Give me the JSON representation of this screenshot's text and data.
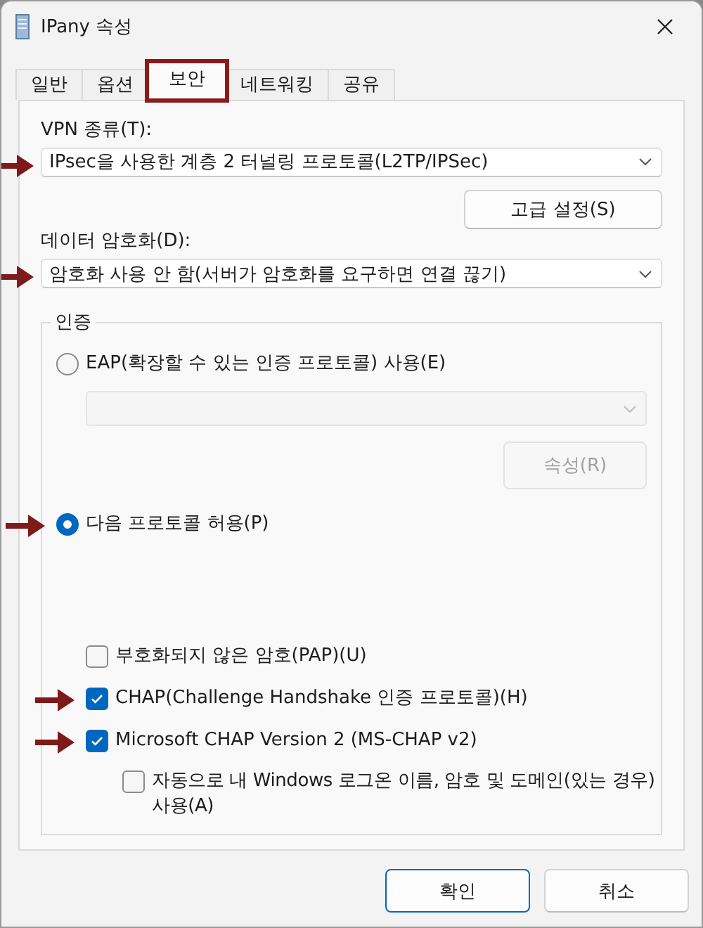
{
  "window": {
    "title": "IPany 속성"
  },
  "tabs": [
    {
      "label": "일반",
      "selected": false,
      "highlighted": false
    },
    {
      "label": "옵션",
      "selected": false,
      "highlighted": false
    },
    {
      "label": "보안",
      "selected": true,
      "highlighted": true
    },
    {
      "label": "네트워킹",
      "selected": false,
      "highlighted": false
    },
    {
      "label": "공유",
      "selected": false,
      "highlighted": false
    }
  ],
  "vpn_type": {
    "label": "VPN 종류(T):",
    "value": "IPsec을 사용한 계층 2 터널링 프로토콜(L2TP/IPSec)",
    "marked": true
  },
  "advanced_button": {
    "label": "고급 설정(S)"
  },
  "encryption": {
    "label": "데이터 암호화(D):",
    "value": "암호화 사용 안 함(서버가 암호화를 요구하면 연결 끊기)",
    "marked": true
  },
  "authentication": {
    "title": "인증",
    "eap_option": {
      "label": "EAP(확장할 수 있는 인증 프로토콜) 사용(E)",
      "selected": false,
      "marked": false
    },
    "eap_dropdown": {
      "disabled": true
    },
    "properties_button": {
      "label": "속성(R)",
      "disabled": true
    },
    "allow_option": {
      "label": "다음 프로토콜 허용(P)",
      "selected": true,
      "marked": true
    },
    "protocols": [
      {
        "label": "부호화되지 않은 암호(PAP)(U)",
        "checked": false,
        "marked": false
      },
      {
        "label": "CHAP(Challenge Handshake 인증 프로토콜)(H)",
        "checked": true,
        "marked": true
      },
      {
        "label": "Microsoft CHAP Version 2 (MS-CHAP v2)",
        "checked": true,
        "marked": true,
        "children": [
          {
            "label": "자동으로 내 Windows 로그온 이름, 암호 및 도메인(있는 경우) 사용(A)",
            "checked": false,
            "marked": false
          }
        ]
      }
    ]
  },
  "buttons": [
    {
      "label": "확인",
      "default": true
    },
    {
      "label": "취소",
      "default": false
    }
  ]
}
